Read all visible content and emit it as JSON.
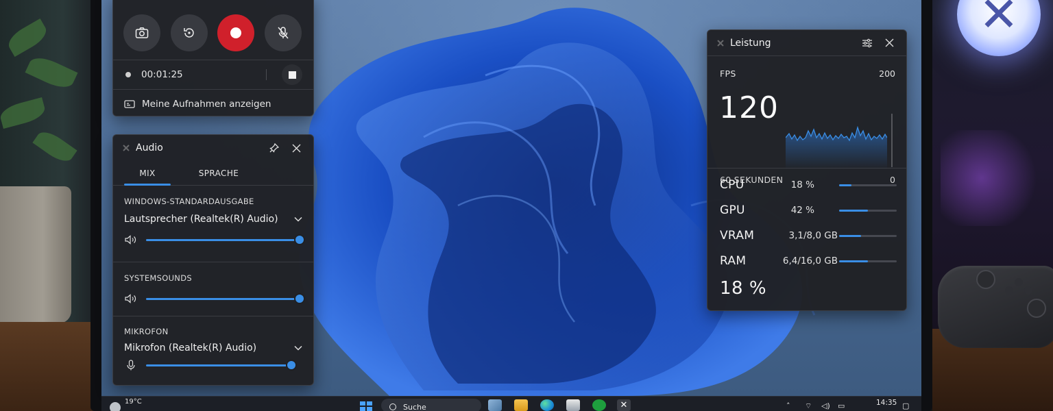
{
  "capture": {
    "timer": "00:01:25",
    "show_recordings_label": "Meine Aufnahmen anzeigen"
  },
  "audio": {
    "title": "Audio",
    "tabs": [
      "MIX",
      "SPRACHE"
    ],
    "output": {
      "label": "WINDOWS-STANDARDAUSGABE",
      "device": "Lautsprecher (Realtek(R) Audio)",
      "volume": 1.0
    },
    "system_sounds": {
      "label": "SYSTEMSOUNDS",
      "volume": 1.0
    },
    "microphone": {
      "label": "MIKROFON",
      "device": "Mikrofon (Realtek(R) Audio)",
      "volume": 0.98
    }
  },
  "performance": {
    "title": "Leistung",
    "fps_label": "FPS",
    "fps_value": "120",
    "fps_max": "200",
    "fps_min": "0",
    "window_label": "60 SEKUNDEN",
    "stats": [
      {
        "name": "CPU",
        "value": "18 %",
        "level": 0.22
      },
      {
        "name": "GPU",
        "value": "42 %",
        "level": 0.5
      },
      {
        "name": "VRAM",
        "value": "3,1/8,0 GB",
        "level": 0.38
      },
      {
        "name": "RAM",
        "value": "6,4/16,0 GB",
        "level": 0.5
      }
    ],
    "big_value": "18 %"
  },
  "taskbar": {
    "temperature": "19°C",
    "search_label": "Suche",
    "time": "14:35"
  },
  "colors": {
    "accent": "#3a8ee6",
    "record": "#d0202b",
    "panel": "#202125"
  }
}
